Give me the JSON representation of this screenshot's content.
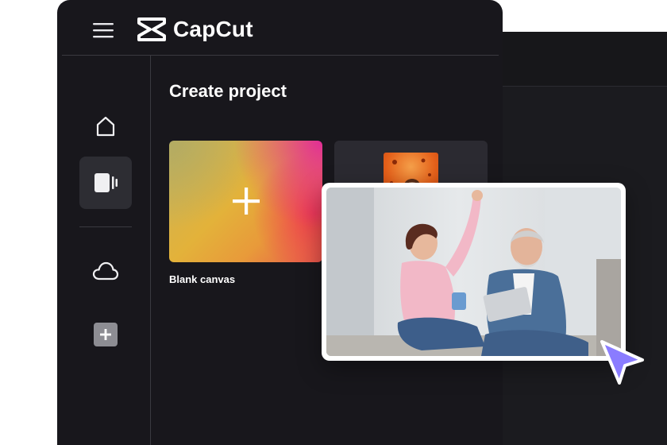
{
  "brand": {
    "name": "CapCut"
  },
  "sidebar": {
    "items": [
      {
        "id": "home",
        "icon": "home-icon",
        "active": false
      },
      {
        "id": "projects",
        "icon": "video-project-icon",
        "active": true
      },
      {
        "id": "cloud",
        "icon": "cloud-icon",
        "active": false
      },
      {
        "id": "new",
        "icon": "plus-square-icon",
        "active": false
      }
    ]
  },
  "main": {
    "title": "Create project",
    "cards": [
      {
        "label": "Blank canvas",
        "icon": "plus-icon"
      },
      {
        "label": "",
        "icon": "template-thumbnail"
      }
    ]
  },
  "overlay": {
    "image": "couple-laughing-photo",
    "cursor_icon": "pointer-cursor-icon"
  },
  "colors": {
    "accent": "#8a7cff",
    "app_bg": "#18171c",
    "card_bg": "#2b2a31"
  }
}
